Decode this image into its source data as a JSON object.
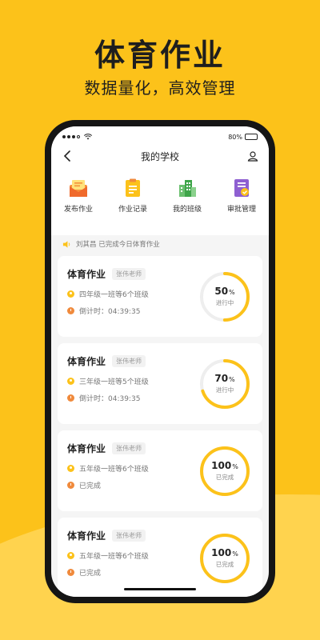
{
  "hero": {
    "title": "体育作业",
    "subtitle": "数据量化，高效管理"
  },
  "status_bar": {
    "battery_text": "80%"
  },
  "nav": {
    "title": "我的学校",
    "back_icon": "chevron-left-icon",
    "user_icon": "user-icon"
  },
  "quick_menu": [
    {
      "label": "发布作业",
      "icon": "envelope-icon"
    },
    {
      "label": "作业记录",
      "icon": "clipboard-icon"
    },
    {
      "label": "我的班级",
      "icon": "building-icon"
    },
    {
      "label": "审批管理",
      "icon": "approval-icon"
    }
  ],
  "notice": {
    "text": "刘其昌 已完成今日体育作业",
    "icon": "speaker-icon"
  },
  "cards": [
    {
      "title": "体育作业",
      "teacher": "张伟老师",
      "classes": "四年级一班等6个班级",
      "timer": "倒计时：04:39:35",
      "progress": "50",
      "progress_fraction": 0.5,
      "percent_sign": "%",
      "status": "进行中"
    },
    {
      "title": "体育作业",
      "teacher": "张伟老师",
      "classes": "三年级一班等5个班级",
      "timer": "倒计时：04:39:35",
      "progress": "70",
      "progress_fraction": 0.7,
      "percent_sign": "%",
      "status": "进行中"
    },
    {
      "title": "体育作业",
      "teacher": "张伟老师",
      "classes": "五年级一班等6个班级",
      "timer": "已完成",
      "progress": "100",
      "progress_fraction": 1.0,
      "percent_sign": "%",
      "status": "已完成"
    },
    {
      "title": "体育作业",
      "teacher": "张伟老师",
      "classes": "五年级一班等6个班级",
      "timer": "已完成",
      "progress": "100",
      "progress_fraction": 1.0,
      "percent_sign": "%",
      "status": "已完成"
    }
  ],
  "colors": {
    "brand_yellow": "#FCC21A",
    "ring_track": "#EEEEEE",
    "timer_orange": "#F08A3C"
  }
}
